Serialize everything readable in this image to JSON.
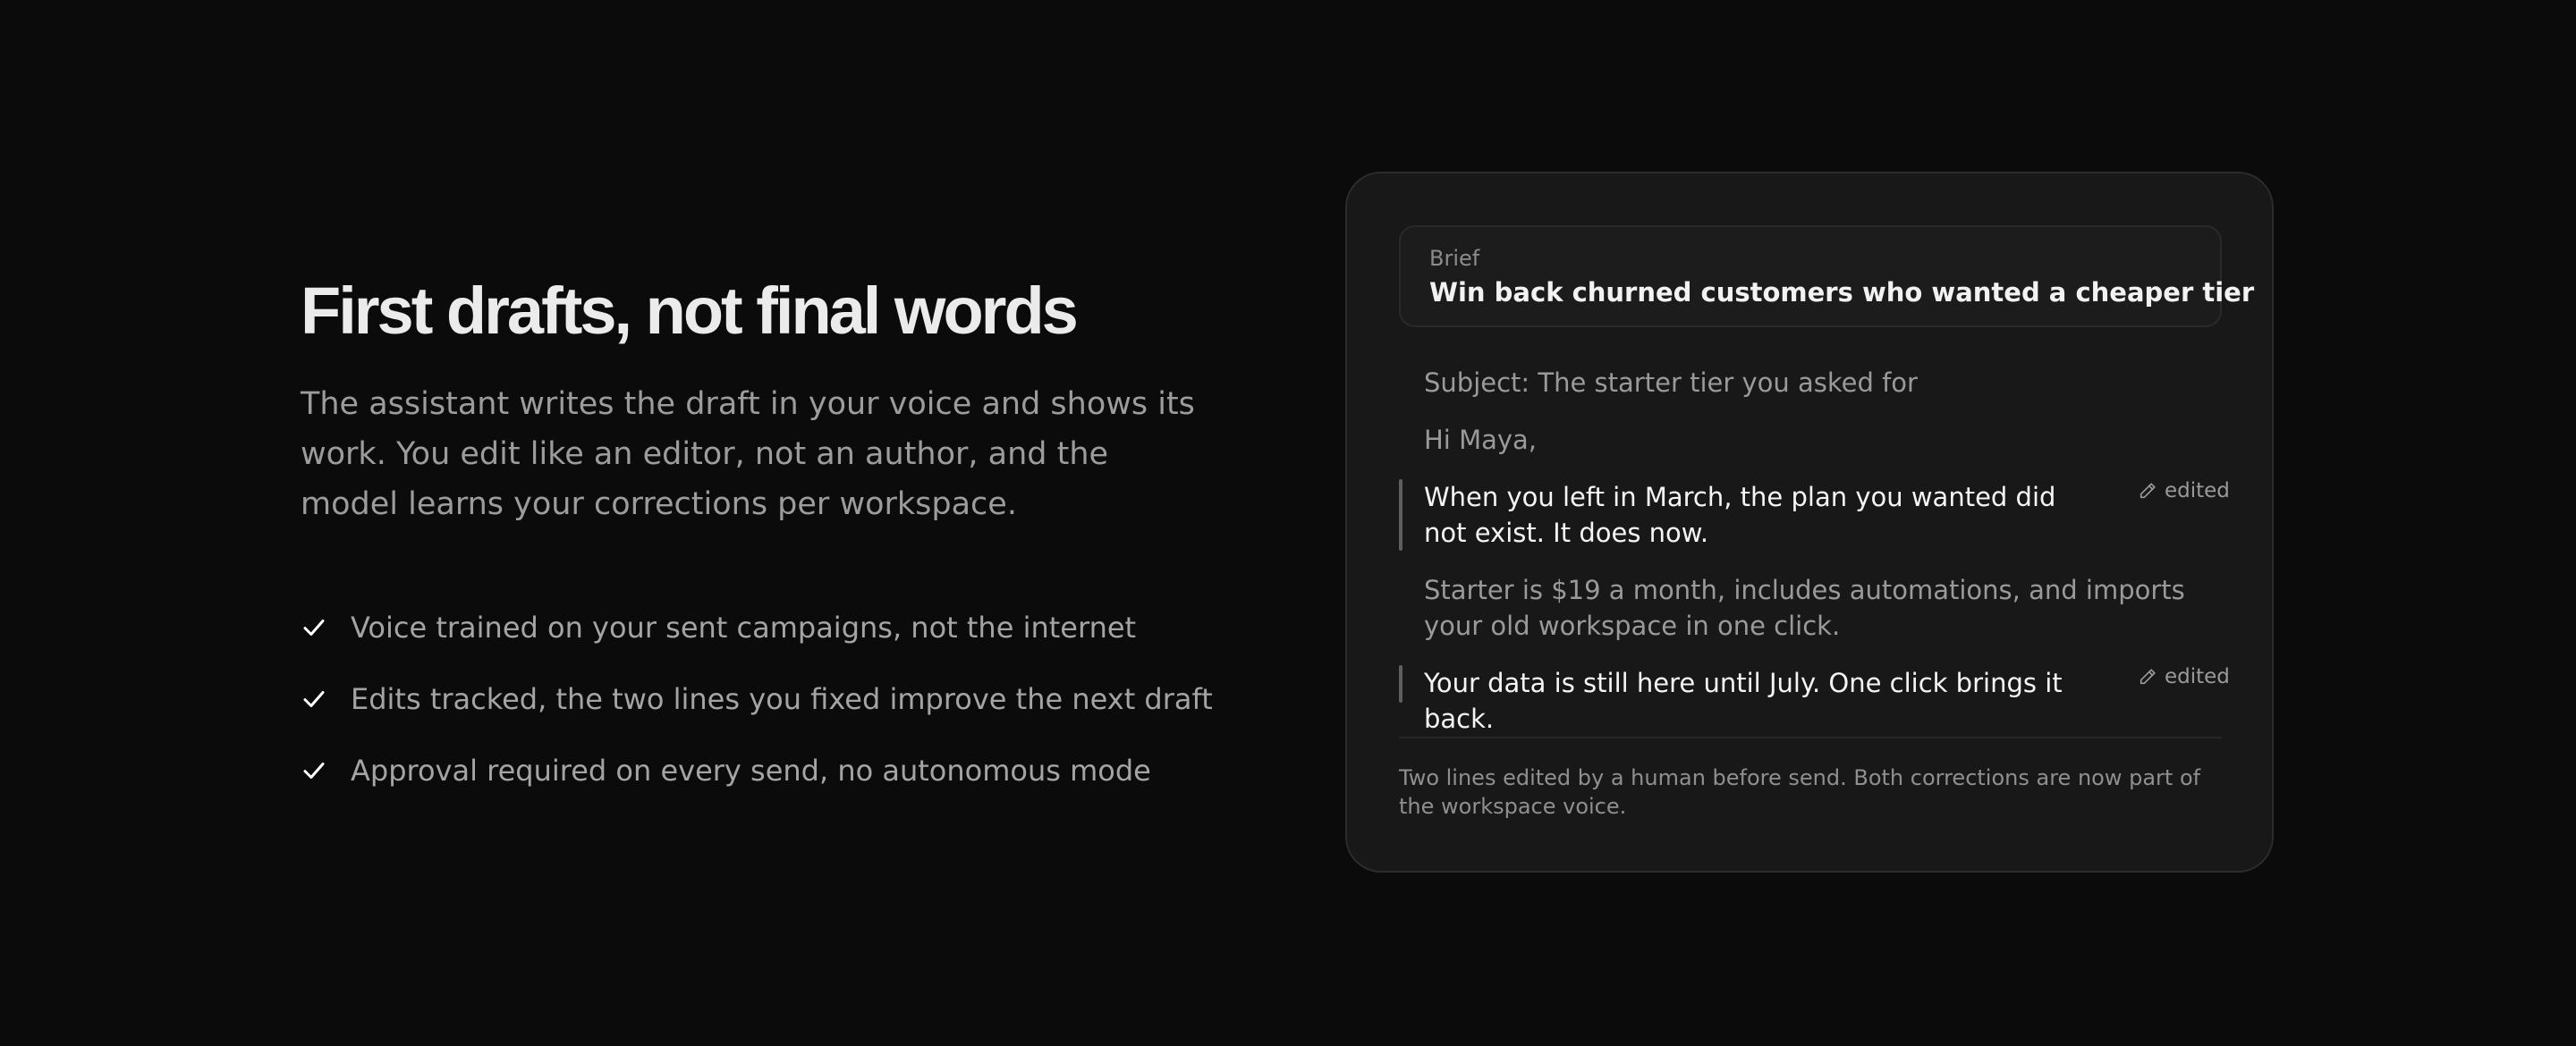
{
  "hero": {
    "headline": "First drafts, not final words",
    "lead": "The assistant writes the draft in your voice and shows its work. You edit like an editor, not an author, and the model learns your corrections per workspace.",
    "features": [
      {
        "icon": "check-icon",
        "text": "Voice trained on your sent campaigns, not the internet"
      },
      {
        "icon": "check-icon",
        "text": "Edits tracked, the two lines you fixed improve the next draft"
      },
      {
        "icon": "check-icon",
        "text": "Approval required on every send, no autonomous mode"
      }
    ]
  },
  "card": {
    "brief_label": "Brief",
    "brief_text": "Win back churned customers who wanted a cheaper tier",
    "email": {
      "subject": "Subject: The starter tier you asked for",
      "greeting": "Hi Maya,",
      "line_edited_1": "When you left in March, the plan you wanted did not exist. It does now.",
      "line_body": "Starter is $19 a month, includes automations, and imports your old workspace in one click.",
      "line_edited_2": "Your data is still here until July. One click brings it back."
    },
    "edited_label": "edited",
    "footnote": "Two lines edited by a human before send. Both corrections are now part of the workspace voice."
  },
  "colors": {
    "background": "#0b0b0b",
    "card": "#181818",
    "text_primary": "#ebebeb",
    "text_muted": "#9c9c9c"
  }
}
